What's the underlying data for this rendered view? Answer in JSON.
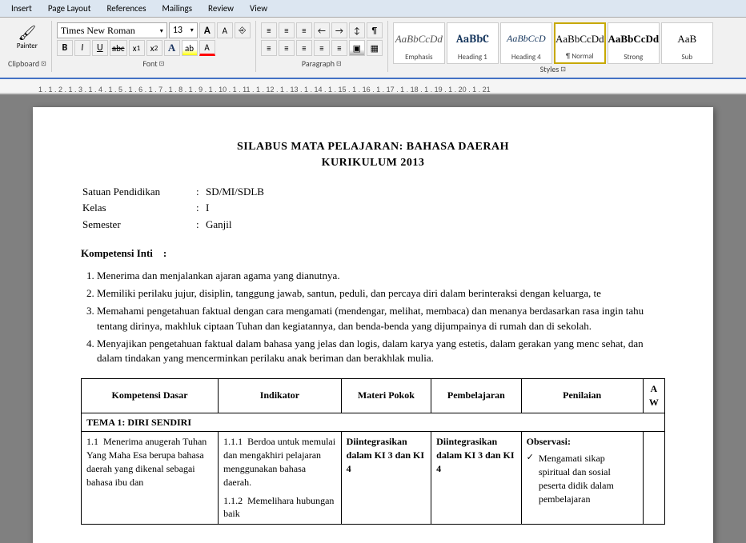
{
  "tabs": [
    "Insert",
    "Page Layout",
    "References",
    "Mailings",
    "Review",
    "View"
  ],
  "font": {
    "name": "Times New Roman",
    "size": "13",
    "name_placeholder": "Times New Roman",
    "size_placeholder": "13"
  },
  "fontButtons": {
    "grow": "A",
    "shrink": "A",
    "clear": "⎆"
  },
  "formatButtons": {
    "bold": "B",
    "italic": "I",
    "underline": "U",
    "strikethrough": "abc",
    "subscript": "x₁",
    "superscript": "x²",
    "texteffects": "A",
    "highlight": "ab",
    "fontcolor": "A"
  },
  "paragraphButtons": {
    "bullets": "≡",
    "numbering": "≡",
    "multilevel": "≡",
    "dec_indent": "←",
    "inc_indent": "→",
    "sort": "↕",
    "show_marks": "¶"
  },
  "alignButtons": {
    "left": "≡",
    "center": "≡",
    "right": "≡",
    "justify": "≡"
  },
  "lineSpacing": "≡",
  "shading": "▣",
  "border": "▦",
  "groupLabels": {
    "clipboard": "Clipboard",
    "font": "Font",
    "paragraph": "Paragraph",
    "styles": "Styles"
  },
  "styles": [
    {
      "id": "emphasis",
      "label": "Emphasis",
      "preview": "AaBbCcDd",
      "active": false
    },
    {
      "id": "heading1",
      "label": "Heading 1",
      "preview": "AaBbC",
      "active": false
    },
    {
      "id": "heading4",
      "label": "Heading 4",
      "preview": "AaBbCcD",
      "active": false
    },
    {
      "id": "normal",
      "label": "¶ Normal",
      "preview": "AaBbCcDd",
      "active": true
    },
    {
      "id": "strong",
      "label": "Strong",
      "preview": "AaBbCcDd",
      "active": false
    },
    {
      "id": "subtitle",
      "label": "Sub",
      "preview": "AaB",
      "active": false
    }
  ],
  "document": {
    "title_line1": "SILABUS MATA PELAJARAN: BAHASA DAERAH",
    "title_line2": "KURIKULUM 2013",
    "meta": [
      {
        "label": "Satuan Pendidikan",
        "value": "SD/MI/SDLB"
      },
      {
        "label": "Kelas",
        "value": "I"
      },
      {
        "label": "Semester",
        "value": "Ganjil"
      }
    ],
    "kompetensi_inti_label": "Kompetensi Inti",
    "ki_items": [
      "Menerima dan menjalankan ajaran agama yang dianutnya.",
      "Memiliki perilaku jujur, disiplin, tanggung jawab, santun, peduli, dan percaya diri dalam berinteraksi dengan keluarga, te",
      "Memahami pengetahuan faktual dengan cara mengamati (mendengar, melihat, membaca) dan menanya berdasarkan rasa ingin tahu tentang dirinya, makhluk ciptaan Tuhan dan kegiatannya, dan benda-benda yang dijumpainya di rumah dan di sekolah.",
      "Menyajikan pengetahuan faktual dalam bahasa yang jelas dan logis, dalam karya yang estetis, dalam gerakan yang menc sehat, dan dalam tindakan yang mencerminkan perilaku anak beriman dan berakhlak mulia."
    ],
    "table": {
      "headers": [
        "Kompetensi Dasar",
        "Indikator",
        "Materi Pokok",
        "Pembelajaran",
        "Penilaian",
        "A W"
      ],
      "tema_row": "TEMA 1: DIRI SENDIRI",
      "rows": [
        {
          "kd_num": "1.1",
          "kd_text": "Menerima anugerah Tuhan Yang Maha Esa berupa bahasa daerah yang dikenal sebagai bahasa ibu dan",
          "indicators": [
            {
              "num": "1.1.1",
              "text": "Berdoa untuk memulai dan mengakhiri pelajaran menggunakan bahasa daerah."
            },
            {
              "num": "1.1.2",
              "text": "Memelihara hubungan baik"
            }
          ],
          "materi": "Diintegrasikan dalam KI 3 dan KI 4",
          "pembelajaran": "Diintegrasikan dalam KI 3 dan KI 4",
          "penilaian": {
            "title": "Observasi:",
            "items": [
              "Mengamati sikap spiritual dan sosial peserta didik dalam pembelajaran"
            ]
          }
        }
      ]
    }
  }
}
